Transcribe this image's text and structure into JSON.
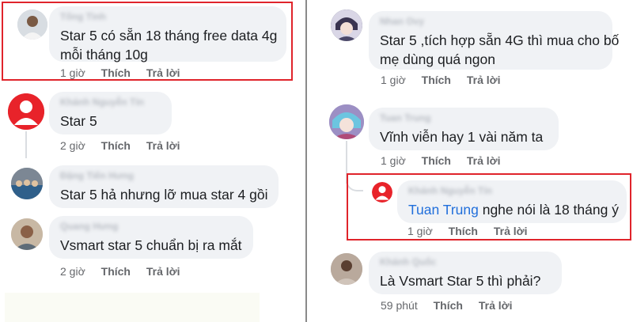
{
  "left_column": {
    "comments": [
      {
        "id": "c1",
        "author_name": "Tống Tình",
        "avatar": "person-photo-icon",
        "text_lines": [
          "Star 5 có sẵn 18 tháng free data 4g",
          "mỗi tháng 10g"
        ],
        "time": "1 giờ",
        "like_label": "Thích",
        "reply_label": "Trả lời",
        "highlighted": true
      },
      {
        "id": "c2",
        "author_name": "Khánh Nguyễn Tín",
        "avatar": "default-user-icon",
        "text_lines": [
          "Star 5"
        ],
        "time": "2 giờ",
        "like_label": "Thích",
        "reply_label": "Trả lời"
      },
      {
        "id": "c3",
        "author_name": "Đặng Tiến Hưng",
        "avatar": "group-photo-icon",
        "text_lines": [
          "Star 5 hả nhưng lỡ mua star 4 gồi"
        ]
      },
      {
        "id": "c4",
        "author_name": "Quang Hưng",
        "avatar": "person-photo-icon",
        "text_lines": [
          "Vsmart star 5 chuẩn bị ra mắt"
        ],
        "time": "2 giờ",
        "like_label": "Thích",
        "reply_label": "Trả lời"
      }
    ]
  },
  "right_column": {
    "comments": [
      {
        "id": "r1",
        "author_name": "Nhan Ovy",
        "avatar": "anime-avatar-icon",
        "text_lines": [
          "Star 5 ,tích hợp sẵn 4G thì mua cho bố",
          "mẹ dùng quá ngon"
        ],
        "time": "1 giờ",
        "like_label": "Thích",
        "reply_label": "Trả lời"
      },
      {
        "id": "r2",
        "author_name": "Tuan Trung",
        "avatar": "anime-avatar-icon",
        "text_lines": [
          "Vĩnh viễn hay 1 vài năm ta"
        ],
        "time": "1 giờ",
        "like_label": "Thích",
        "reply_label": "Trả lời"
      },
      {
        "id": "r3",
        "author_name": "Khánh Nguyễn Tín",
        "avatar": "default-user-icon",
        "mention": "Tuan Trung",
        "text": " nghe nói là 18 tháng ý",
        "time": "1 giờ",
        "like_label": "Thích",
        "reply_label": "Trả lời",
        "highlighted": true
      },
      {
        "id": "r4",
        "author_name": "Khánh Quốc",
        "avatar": "person-photo-icon",
        "text_lines": [
          "Là Vsmart Star 5 thì phải?"
        ],
        "time": "59 phút",
        "like_label": "Thích",
        "reply_label": "Trả lời"
      }
    ]
  },
  "colors": {
    "bubble": "#f0f2f5",
    "highlight_border": "#e0242b",
    "mention_link": "#216fdb",
    "meta_text": "#65676b",
    "divider": "#8a8a8a"
  }
}
